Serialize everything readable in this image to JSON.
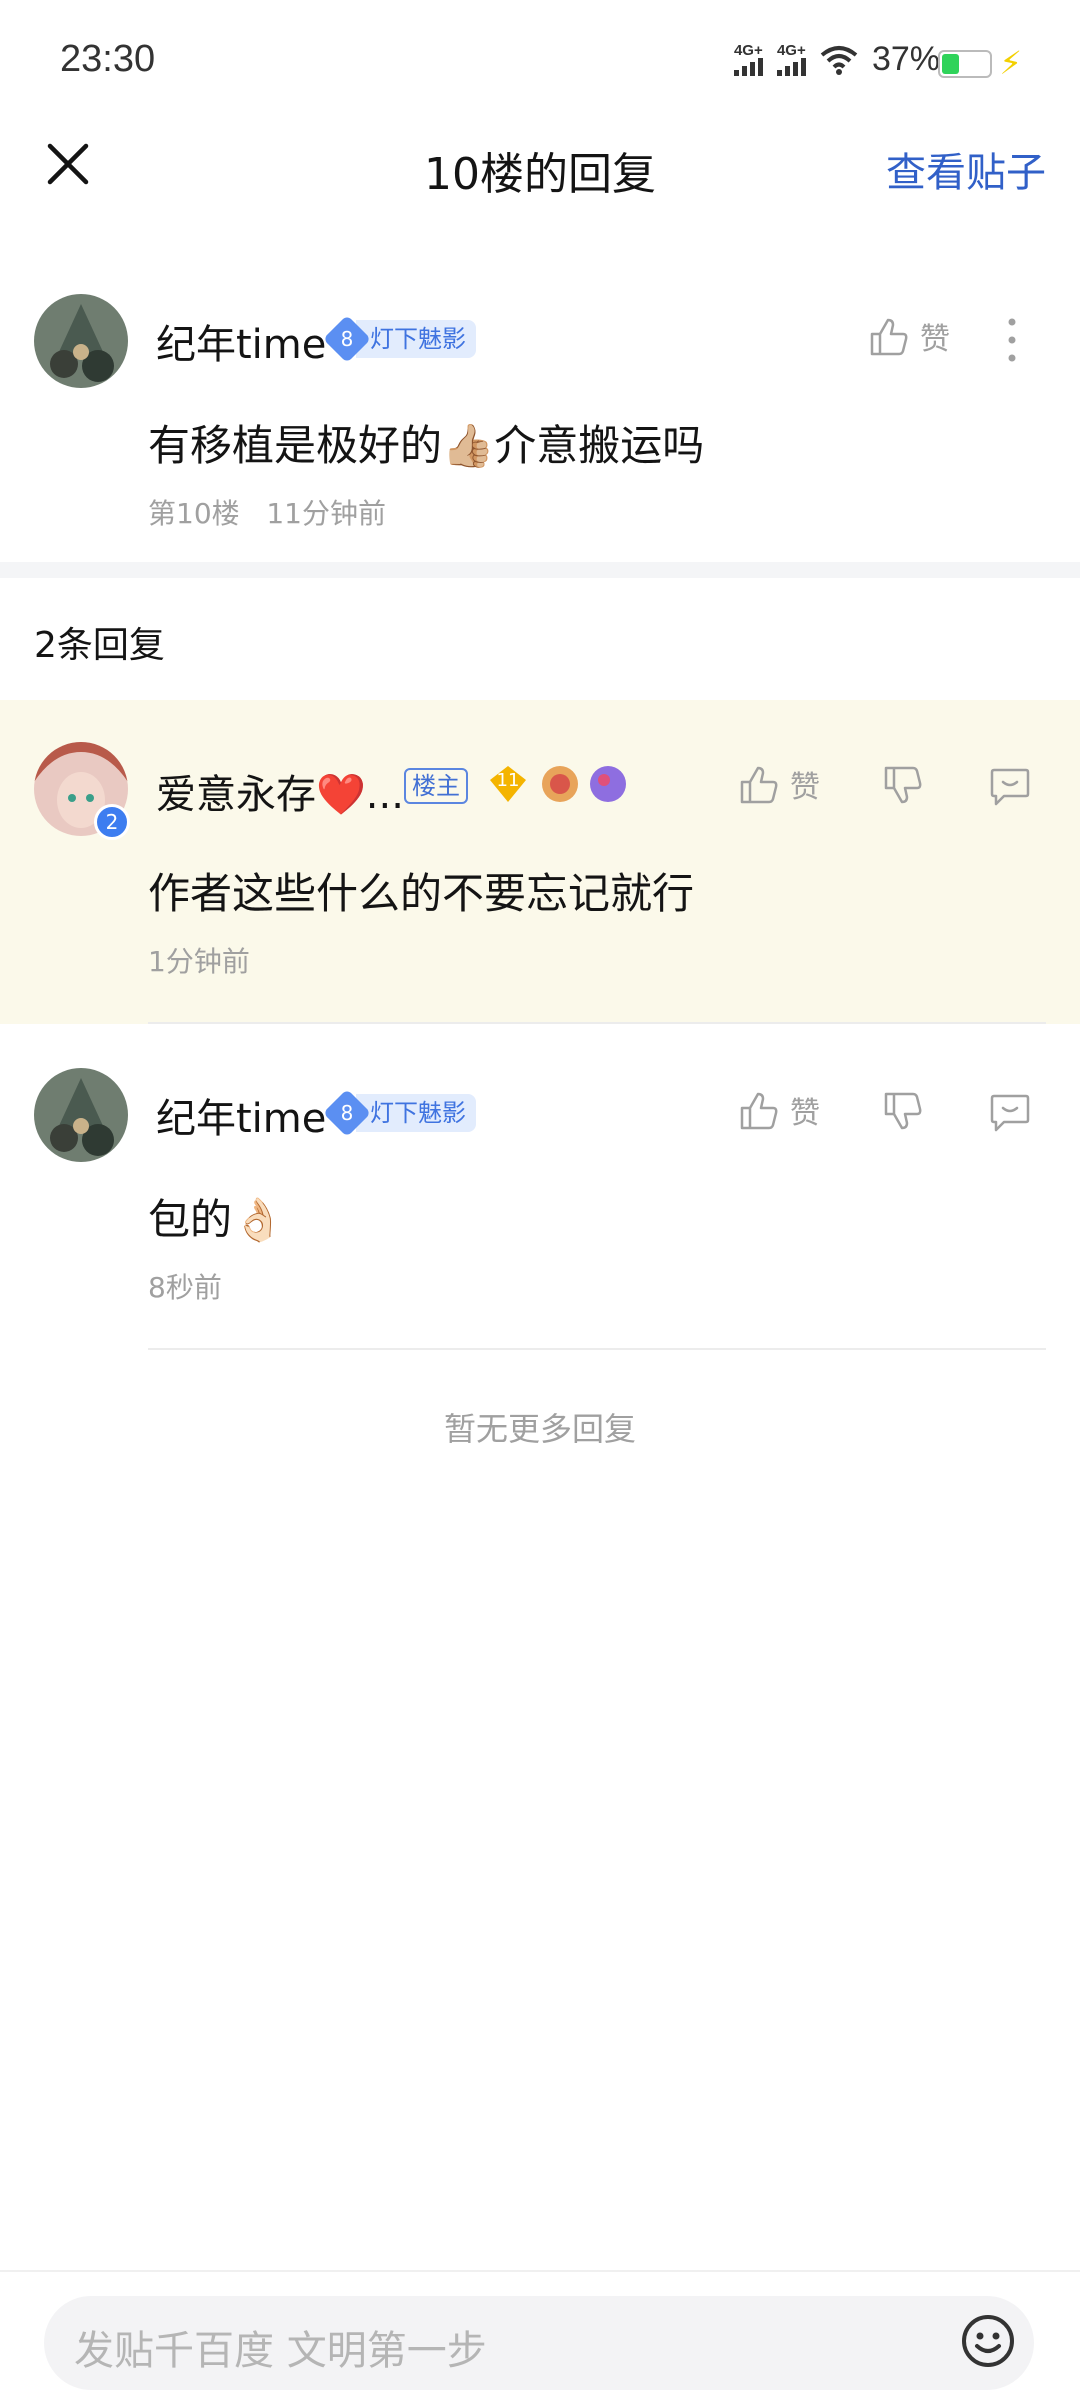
{
  "status_bar": {
    "time": "23:30",
    "net1": "4G+",
    "net2": "4G+",
    "battery": "37%",
    "battery_level": 0.37
  },
  "header": {
    "title": "10楼的回复",
    "view_post": "查看贴子"
  },
  "main_post": {
    "username": "纪年time",
    "level": "8",
    "level_title": "灯下魅影",
    "like_label": "赞",
    "content": "有移植是极好的👍🏼介意搬运吗",
    "floor": "第10楼",
    "time": "11分钟前"
  },
  "reply_count": "2条回复",
  "replies": [
    {
      "username": "爱意永存❤️...",
      "host_tag": "楼主",
      "badge_level": "11",
      "avatar_badge": "2",
      "like_label": "赞",
      "content": "作者这些什么的不要忘记就行",
      "time": "1分钟前"
    },
    {
      "username": "纪年time",
      "level": "8",
      "level_title": "灯下魅影",
      "like_label": "赞",
      "content": "包的👌🏻",
      "time": "8秒前"
    }
  ],
  "no_more": "暂无更多回复",
  "input": {
    "placeholder": "发贴千百度 文明第一步"
  },
  "colors": {
    "accent": "#3160c8",
    "highlight_bg": "#fbf9ea",
    "level_blue": "#5b8ff2"
  }
}
